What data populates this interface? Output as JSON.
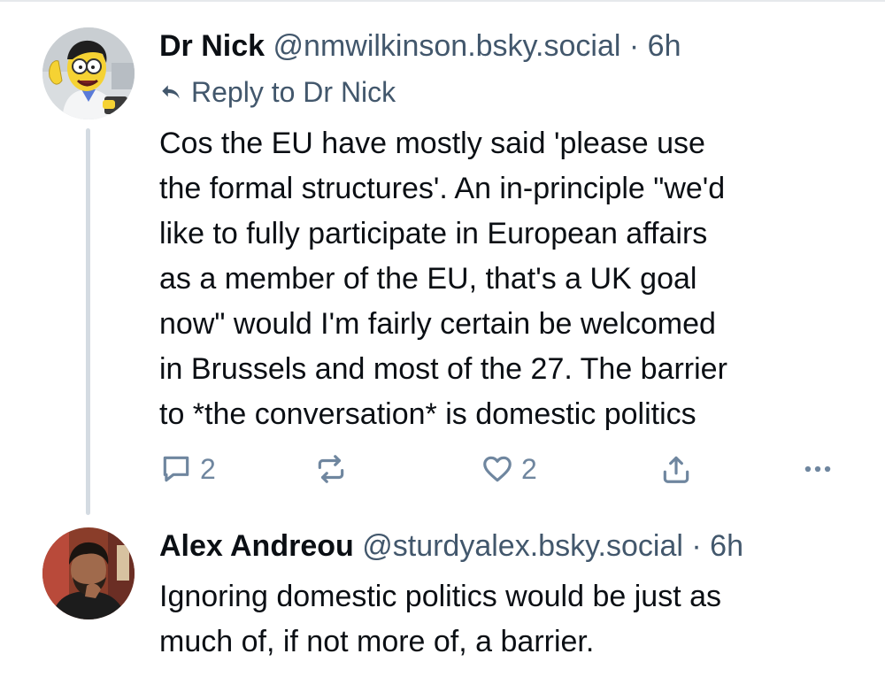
{
  "posts": [
    {
      "author": "Dr Nick",
      "handle": "@nmwilkinson.bsky.social",
      "separator": "·",
      "time": "6h",
      "reply_to": "Reply to Dr Nick",
      "lines": [
        "Cos the EU have mostly said 'please use",
        "the formal structures'. An in-principle \"we'd",
        "like to fully participate in European affairs",
        "as a member of the EU, that's a UK goal",
        "now\" would I'm fairly certain be welcomed",
        "in Brussels and most of the 27. The barrier",
        "to *the conversation* is domestic politics"
      ],
      "reply_count": "2",
      "like_count": "2"
    },
    {
      "author": "Alex Andreou",
      "handle": "@sturdyalex.bsky.social",
      "separator": "·",
      "time": "6h",
      "lines": [
        "Ignoring domestic politics would be just as",
        "much of, if not more of, a barrier."
      ]
    }
  ],
  "icons": {
    "reply": "speech-bubble-icon",
    "repost": "repost-arrows-icon",
    "like": "heart-icon",
    "share": "share-upload-icon",
    "more": "ellipsis-icon",
    "reply_to": "reply-arrow-icon"
  },
  "colors": {
    "text": "#0b0f14",
    "muted": "#42576c",
    "icon": "#6f869f",
    "thread_line": "#d4dbe2"
  }
}
